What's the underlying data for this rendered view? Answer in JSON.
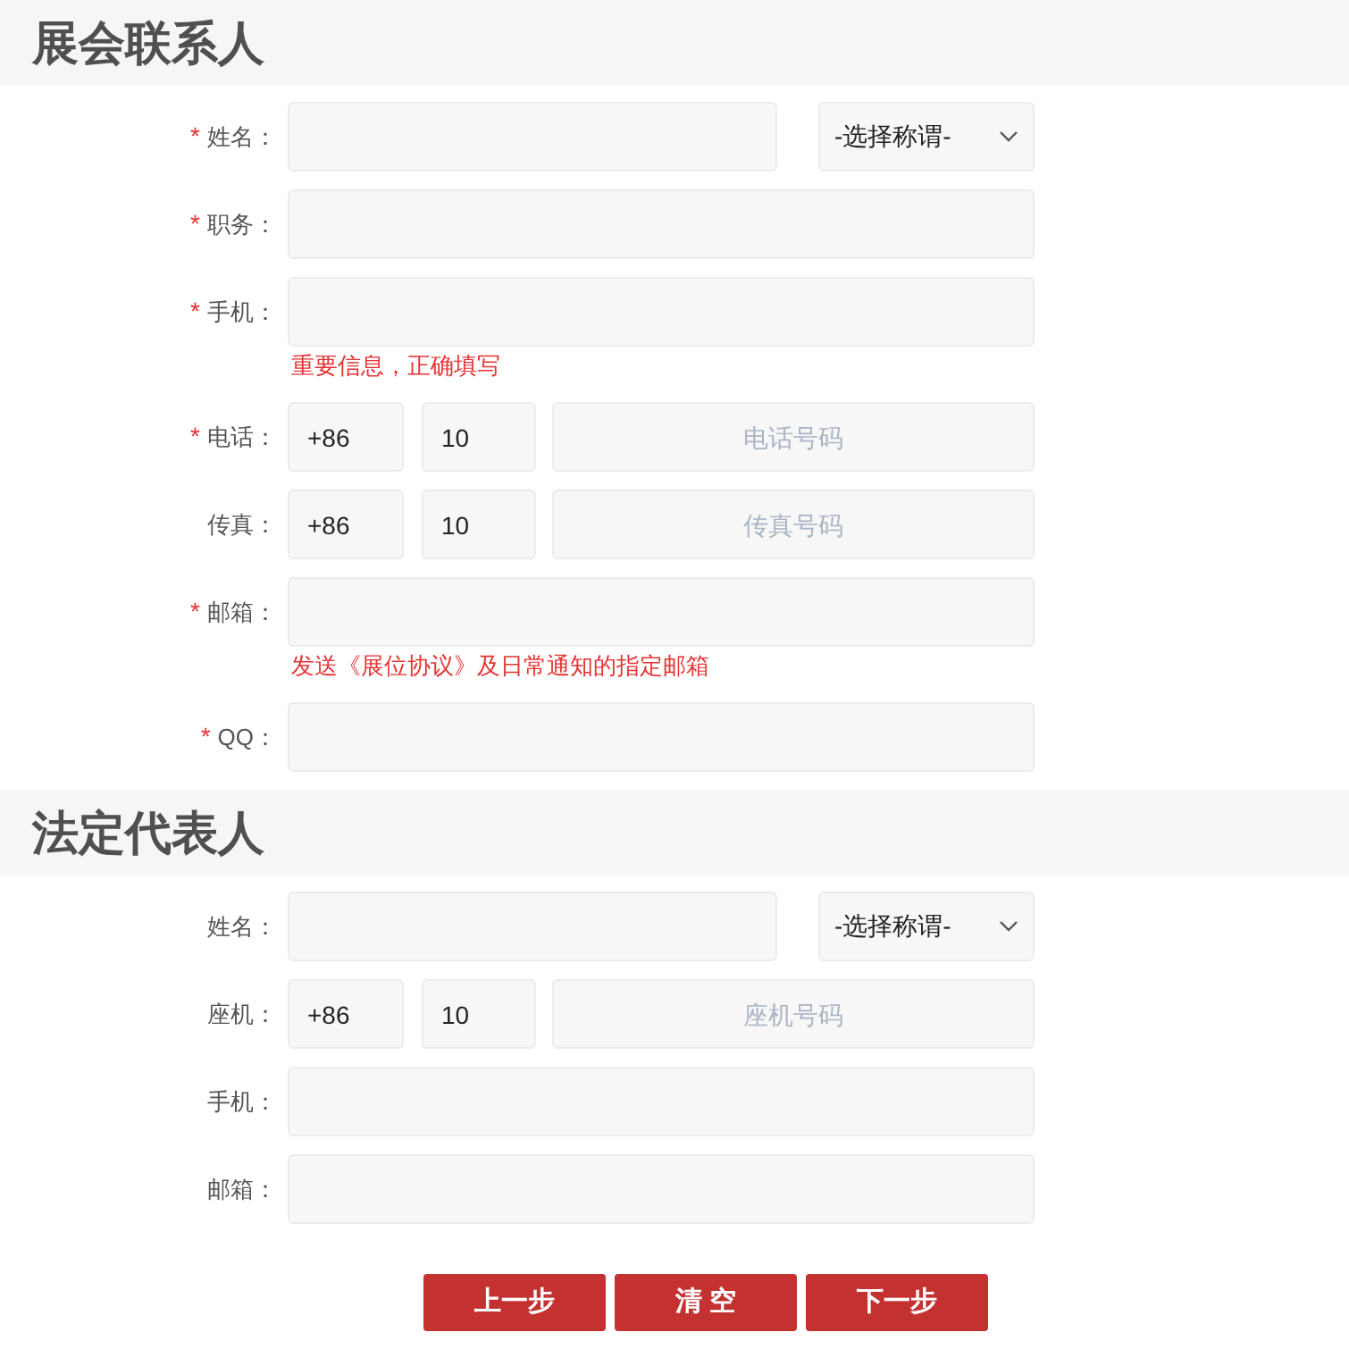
{
  "sections": [
    {
      "title": "展会联系人",
      "fields": [
        {
          "kind": "name",
          "marker": "*",
          "label": "姓名：",
          "select": "-选择称谓-"
        },
        {
          "kind": "text",
          "marker": "*",
          "label": "职务："
        },
        {
          "kind": "text",
          "marker": "*",
          "label": "手机：",
          "hint": "重要信息，正确填写"
        },
        {
          "kind": "phone",
          "marker": "*",
          "label": "电话：",
          "country": "+86",
          "area": "10",
          "placeholder": "电话号码"
        },
        {
          "kind": "phone",
          "label": "传真：",
          "country": "+86",
          "area": "10",
          "placeholder": "传真号码"
        },
        {
          "kind": "text",
          "marker": "*",
          "label": "邮箱：",
          "hint": "发送《展位协议》及日常通知的指定邮箱"
        },
        {
          "kind": "text",
          "marker": "*",
          "label": "QQ："
        }
      ]
    },
    {
      "title": "法定代表人",
      "fields": [
        {
          "kind": "name",
          "label": "姓名：",
          "select": "-选择称谓-"
        },
        {
          "kind": "phone",
          "label": "座机：",
          "country": "+86",
          "area": "10",
          "placeholder": "座机号码"
        },
        {
          "kind": "text",
          "label": "手机："
        },
        {
          "kind": "text",
          "label": "邮箱："
        }
      ]
    }
  ],
  "buttons": [
    "上一步",
    "清 空",
    "下一步"
  ]
}
